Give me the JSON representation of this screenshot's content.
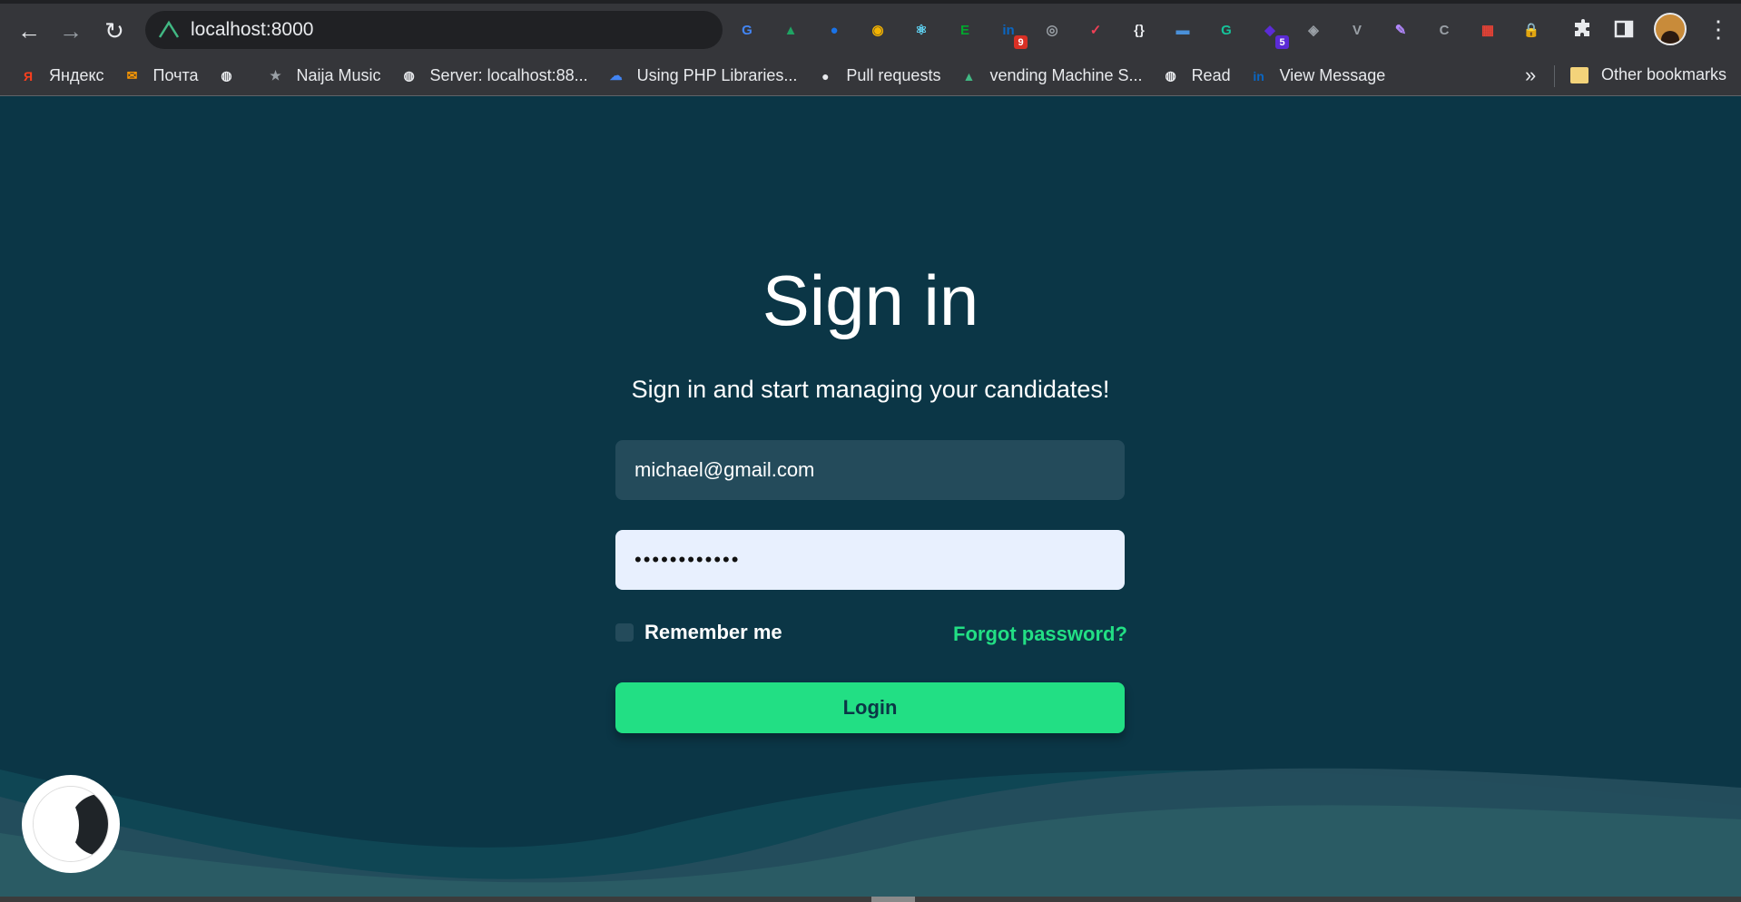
{
  "browser": {
    "url": "localhost:8000",
    "nav": {
      "back": "←",
      "forward": "→",
      "reload": "↻"
    },
    "extensions": [
      {
        "icon": "google-translate-icon",
        "label": "G",
        "color": "#4285f4"
      },
      {
        "icon": "google-drive-icon",
        "label": "▲",
        "color": "#1fa463"
      },
      {
        "icon": "globe-blue-icon",
        "label": "●",
        "color": "#1a73e8"
      },
      {
        "icon": "compass-icon",
        "label": "◉",
        "color": "#f4b400"
      },
      {
        "icon": "react-devtools-icon",
        "label": "⚛",
        "color": "#61dafb"
      },
      {
        "icon": "evernote-icon",
        "label": "E",
        "color": "#00a82d"
      },
      {
        "icon": "linkedin-icon",
        "label": "in",
        "color": "#0a66c2",
        "badge": "9",
        "badge_color": "#d93025"
      },
      {
        "icon": "target-icon",
        "label": "◎",
        "color": "#9aa0a6"
      },
      {
        "icon": "pocket-icon",
        "label": "✓",
        "color": "#ef4056"
      },
      {
        "icon": "json-viewer-icon",
        "label": "{}",
        "color": "#e8eaed"
      },
      {
        "icon": "note-icon",
        "label": "▬",
        "color": "#4a90d9"
      },
      {
        "icon": "grammarly-icon",
        "label": "G",
        "color": "#15c39a"
      },
      {
        "icon": "gem-icon",
        "label": "◆",
        "color": "#5b2bd6",
        "badge": "5",
        "badge_color": "#5b2bd6"
      },
      {
        "icon": "layers-icon",
        "label": "◈",
        "color": "#9aa0a6"
      },
      {
        "icon": "vue-devtools-icon",
        "label": "V",
        "color": "#9aa0a6"
      },
      {
        "icon": "feather-icon",
        "label": "✎",
        "color": "#b388ff"
      },
      {
        "icon": "css-icon",
        "label": "C",
        "color": "#9aa0a6"
      },
      {
        "icon": "color-grid-icon",
        "label": "▦",
        "color": "#e94235"
      },
      {
        "icon": "lock-icon",
        "label": "🔒",
        "color": "#f9ab00"
      }
    ],
    "bookmarks": [
      {
        "icon": "yandex-icon",
        "glyph": "Я",
        "color": "#fc3f1d",
        "label": "Яндекс"
      },
      {
        "icon": "mail-icon",
        "glyph": "✉",
        "color": "#ff9900",
        "label": "Почта"
      },
      {
        "icon": "globe-icon",
        "glyph": "◍",
        "color": "#e8eaed",
        "label": ""
      },
      {
        "icon": "naija-music-icon",
        "glyph": "★",
        "color": "#9aa0a6",
        "label": "Naija Music"
      },
      {
        "icon": "globe-icon",
        "glyph": "◍",
        "color": "#e8eaed",
        "label": "Server: localhost:88..."
      },
      {
        "icon": "google-cloud-icon",
        "glyph": "☁",
        "color": "#4285f4",
        "label": "Using PHP Libraries..."
      },
      {
        "icon": "github-icon",
        "glyph": "●",
        "color": "#e8eaed",
        "label": "Pull requests"
      },
      {
        "icon": "vuetify-icon",
        "glyph": "▲",
        "color": "#41b883",
        "label": "vending Machine S..."
      },
      {
        "icon": "globe-icon",
        "glyph": "◍",
        "color": "#e8eaed",
        "label": "Read"
      },
      {
        "icon": "linkedin-icon",
        "glyph": "in",
        "color": "#0a66c2",
        "label": "View Message"
      }
    ],
    "more_bookmarks": "»",
    "other_bookmarks": "Other bookmarks"
  },
  "page": {
    "title": "Sign in",
    "subtitle": "Sign in and start managing your candidates!",
    "email_value": "michael@gmail.com",
    "password_value": "password1234",
    "remember_label": "Remember me",
    "forgot_label": "Forgot password?",
    "login_label": "Login"
  },
  "colors": {
    "background": "#0b3646",
    "accent": "#22df84",
    "input_dark": "#244b5b",
    "input_light": "#e8f0fe"
  }
}
